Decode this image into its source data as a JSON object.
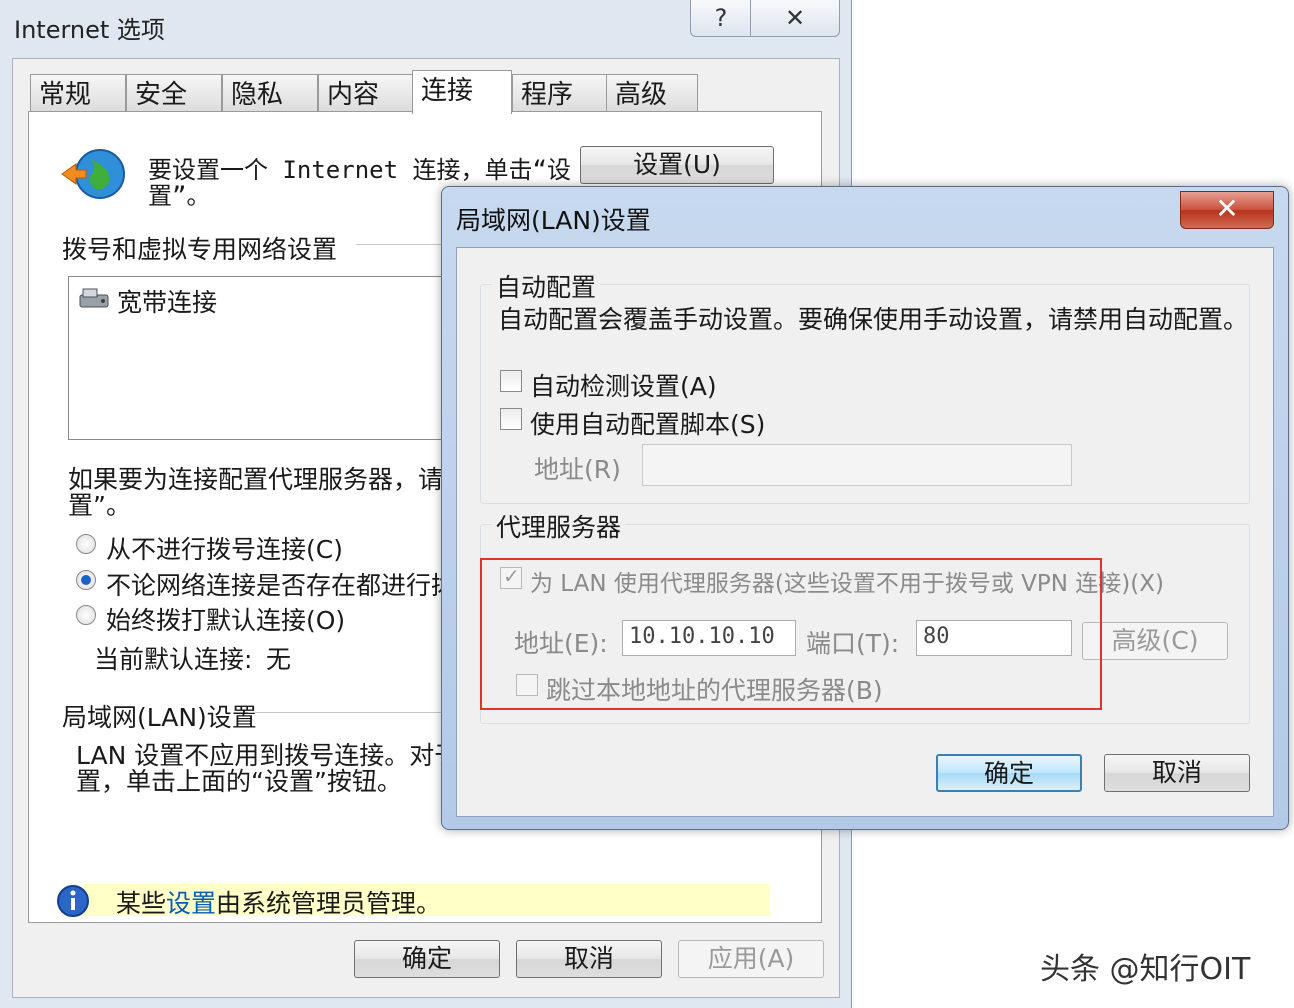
{
  "main_window": {
    "title": "Internet 选项",
    "help_button": "?",
    "close_button": "✕",
    "tabs": [
      "常规",
      "安全",
      "隐私",
      "内容",
      "连接",
      "程序",
      "高级"
    ],
    "active_tab": "连接",
    "setup_text_line1": "要设置一个 Internet 连接，单击“设",
    "setup_text_line2": "置”。",
    "setup_button": "设置(U)",
    "dialup_section": "拨号和虚拟专用网络设置",
    "connection_item": "宽带连接",
    "proxy_text_line1": "如果要为连接配置代理服务器，请选",
    "proxy_text_line2": "置”。",
    "radio_options": [
      "从不进行拨号连接(C)",
      "不论网络连接是否存在都进行拨",
      "始终拨打默认连接(O)"
    ],
    "selected_radio": 1,
    "default_connection_label": "当前默认连接:",
    "default_connection_value": "无",
    "lan_section": "局域网(LAN)设置",
    "lan_text_line1": "LAN 设置不应用到拨号连接。对于拨",
    "lan_text_line2": "置，单击上面的“设置”按钮。",
    "info_prefix": "某些",
    "info_link": "设置",
    "info_suffix": "由系统管理员管理。",
    "ok_button": "确定",
    "cancel_button": "取消",
    "apply_button": "应用(A)"
  },
  "lan_dialog": {
    "title": "局域网(LAN)设置",
    "close_button": "✕",
    "auto_config_label": "自动配置",
    "auto_config_desc": "自动配置会覆盖手动设置。要确保使用手动设置，请禁用自动配置。",
    "auto_detect_label": "自动检测设置(A)",
    "auto_detect_checked": false,
    "auto_script_label": "使用自动配置脚本(S)",
    "auto_script_checked": false,
    "script_address_label": "地址(R)",
    "script_address_value": "",
    "proxy_label": "代理服务器",
    "use_proxy_label": "为 LAN 使用代理服务器(这些设置不用于拨号或 VPN 连接)(X)",
    "use_proxy_checked": true,
    "proxy_address_label": "地址(E):",
    "proxy_address_value": "10.10.10.10",
    "proxy_port_label": "端口(T):",
    "proxy_port_value": "80",
    "advanced_button": "高级(C)",
    "bypass_local_label": "跳过本地地址的代理服务器(B)",
    "bypass_local_checked": false,
    "ok_button": "确定",
    "cancel_button": "取消"
  },
  "watermark": "头条 @知行OIT",
  "colors": {
    "highlight_box": "#e0342b",
    "info_background": "#ffffc8",
    "link": "#0a5ab8",
    "default_button_border": "#3c7fb1"
  }
}
